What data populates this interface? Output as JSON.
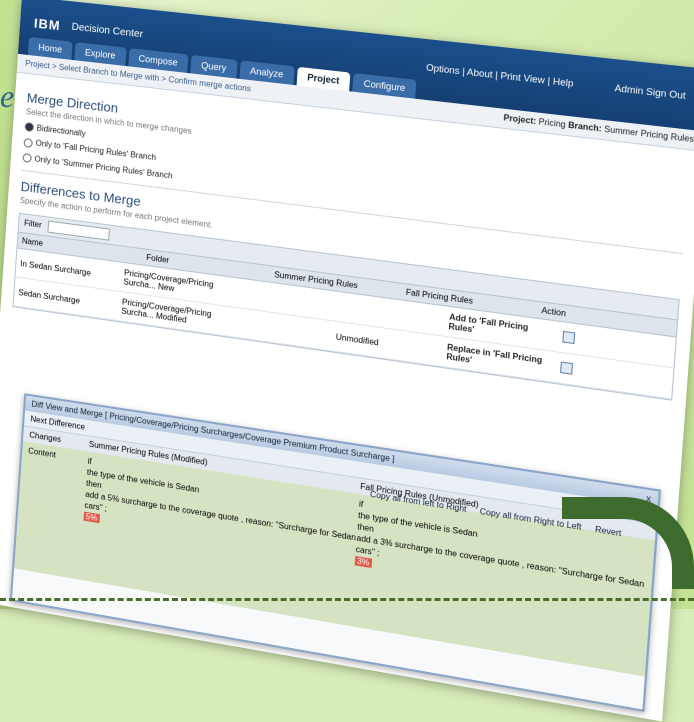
{
  "background": {
    "decor_letter": "e"
  },
  "app": {
    "logo": "IBM",
    "product": "Decision Center",
    "toplinks": "Options | About | Print View | Help",
    "user": "Admin  Sign Out",
    "tabs": [
      "Home",
      "Explore",
      "Compose",
      "Query",
      "Analyze",
      "Project",
      "Configure"
    ],
    "active_tab": "Project",
    "breadcrumb": "Project > Select Branch to Merge with > Confirm merge actions",
    "project_label": "Project:",
    "project_value": "Pricing",
    "branch_label": "Branch:",
    "branch_value": "Summer Pricing Rules"
  },
  "merge_direction": {
    "title": "Merge Direction",
    "hint": "Select the direction in which to merge changes",
    "options": [
      {
        "label": "Bidirectionally",
        "selected": true
      },
      {
        "label": "Only to 'Fall Pricing Rules' Branch",
        "selected": false
      },
      {
        "label": "Only to 'Summer Pricing Rules' Branch",
        "selected": false
      }
    ]
  },
  "differences": {
    "title": "Differences to Merge",
    "hint": "Specify the action to perform for each project element.",
    "filter_label": "Filter",
    "columns": [
      "Name",
      "Folder",
      "Summer Pricing Rules",
      "Fall Pricing Rules",
      "Action"
    ],
    "rows": [
      {
        "name": "In Sedan Surcharge",
        "folder": "Pricing/Coverage/Pricing Surcha... New",
        "summer": "",
        "fall": "",
        "action": "Add to 'Fall Pricing Rules'"
      },
      {
        "name": "Sedan Surcharge",
        "folder": "Pricing/Coverage/Pricing Surcha... Modified",
        "summer": "",
        "fall": "Unmodified",
        "action": "Replace in 'Fall Pricing Rules'"
      }
    ]
  },
  "dialog": {
    "title": "Diff View and Merge [ Pricing/Coverage/Pricing Surcharges/Coverage Premium Product Surcharge ]",
    "toolbar": "Next Difference",
    "buttons": [
      "Copy all from left to Right",
      "Copy all from Right to Left",
      "Revert"
    ],
    "col_headers": [
      "Changes",
      "Summer Pricing Rules (Modified)",
      "Fall Pricing Rules (Unmodified)"
    ],
    "row_label": "Content",
    "left_lines": [
      "if",
      "the type of the vehicle is Sedan",
      "then",
      "add a 5% surcharge to the coverage quote , reason: \"Surcharge for Sedan cars\" ;"
    ],
    "right_lines": [
      "if",
      "the type of the vehicle is Sedan",
      "then",
      "add a 3% surcharge to the coverage quote , reason: \"Surcharge for Sedan cars\" ;"
    ],
    "left_hl": "5%",
    "right_hl": "3%",
    "close": "x"
  }
}
